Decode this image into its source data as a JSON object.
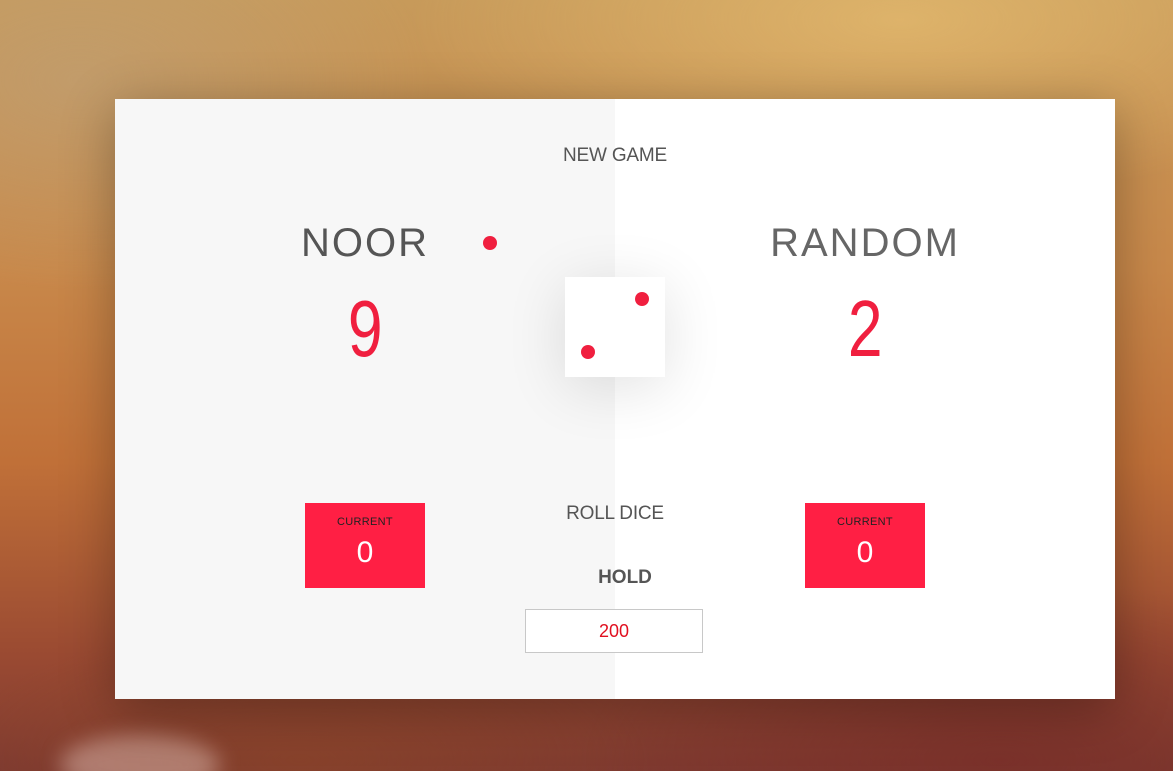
{
  "buttons": {
    "new_game": "NEW GAME",
    "roll_dice": "ROLL DICE",
    "hold": "HOLD"
  },
  "players": [
    {
      "name": "NOOR",
      "score": "9",
      "current_label": "CURRENT",
      "current_score": "0",
      "active": true
    },
    {
      "name": "RANDOM",
      "score": "2",
      "current_label": "CURRENT",
      "current_score": "0",
      "active": false
    }
  ],
  "final_score": {
    "value": "200"
  },
  "dice": {
    "value": 2
  },
  "colors": {
    "accent": "#f01f3f",
    "current_box": "#ff1f44",
    "panel_active": "#f7f7f7",
    "panel_inactive": "#ffffff",
    "text": "#555555"
  }
}
